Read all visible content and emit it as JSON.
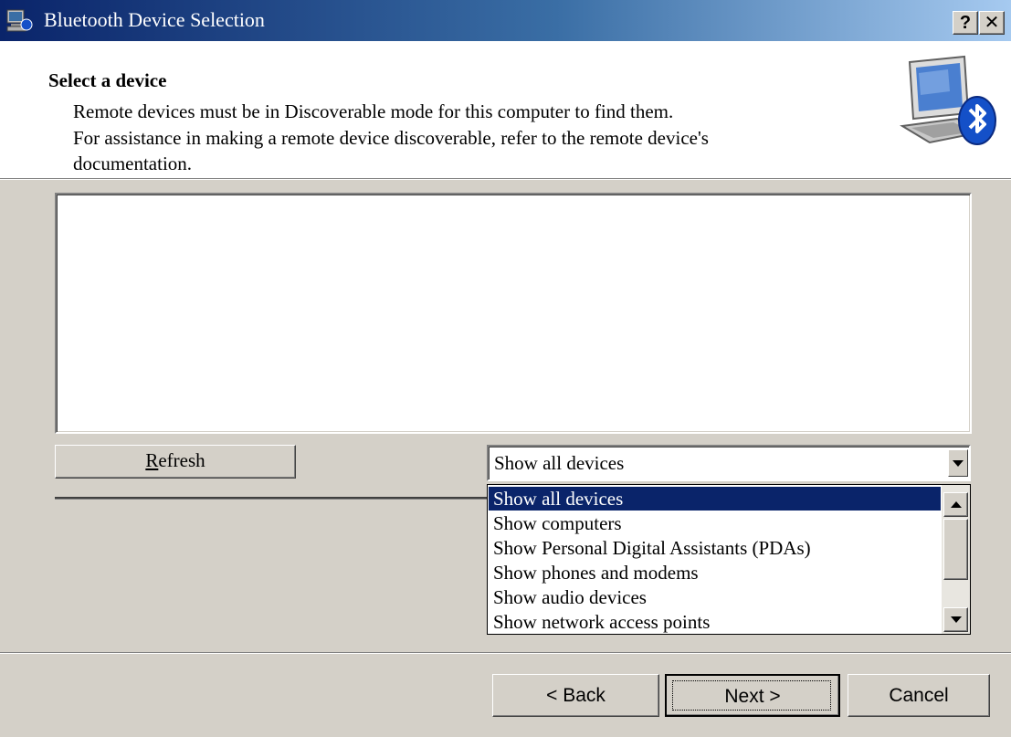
{
  "window": {
    "title": "Bluetooth Device Selection",
    "help_label": "?",
    "close_label": "✕"
  },
  "header": {
    "title": "Select a device",
    "description_lines": [
      "Remote devices must be in Discoverable mode for this computer to find them.",
      "For assistance in making a remote device discoverable, refer to the remote device's",
      "documentation."
    ]
  },
  "device_list": {
    "items": []
  },
  "refresh": {
    "label_prefix": "R",
    "label_rest": "efresh"
  },
  "filter": {
    "selected": "Show all devices",
    "options": [
      "Show all devices",
      "Show computers",
      "Show Personal Digital Assistants (PDAs)",
      "Show phones and modems",
      "Show audio devices",
      "Show network access points"
    ],
    "highlighted_index": 0
  },
  "buttons": {
    "back": "< Back",
    "next": "Next >",
    "cancel": "Cancel"
  },
  "colors": {
    "face": "#d4d0c8",
    "selection": "#0a246a",
    "titlebar_start": "#0a246a",
    "titlebar_end": "#a6caf0"
  }
}
